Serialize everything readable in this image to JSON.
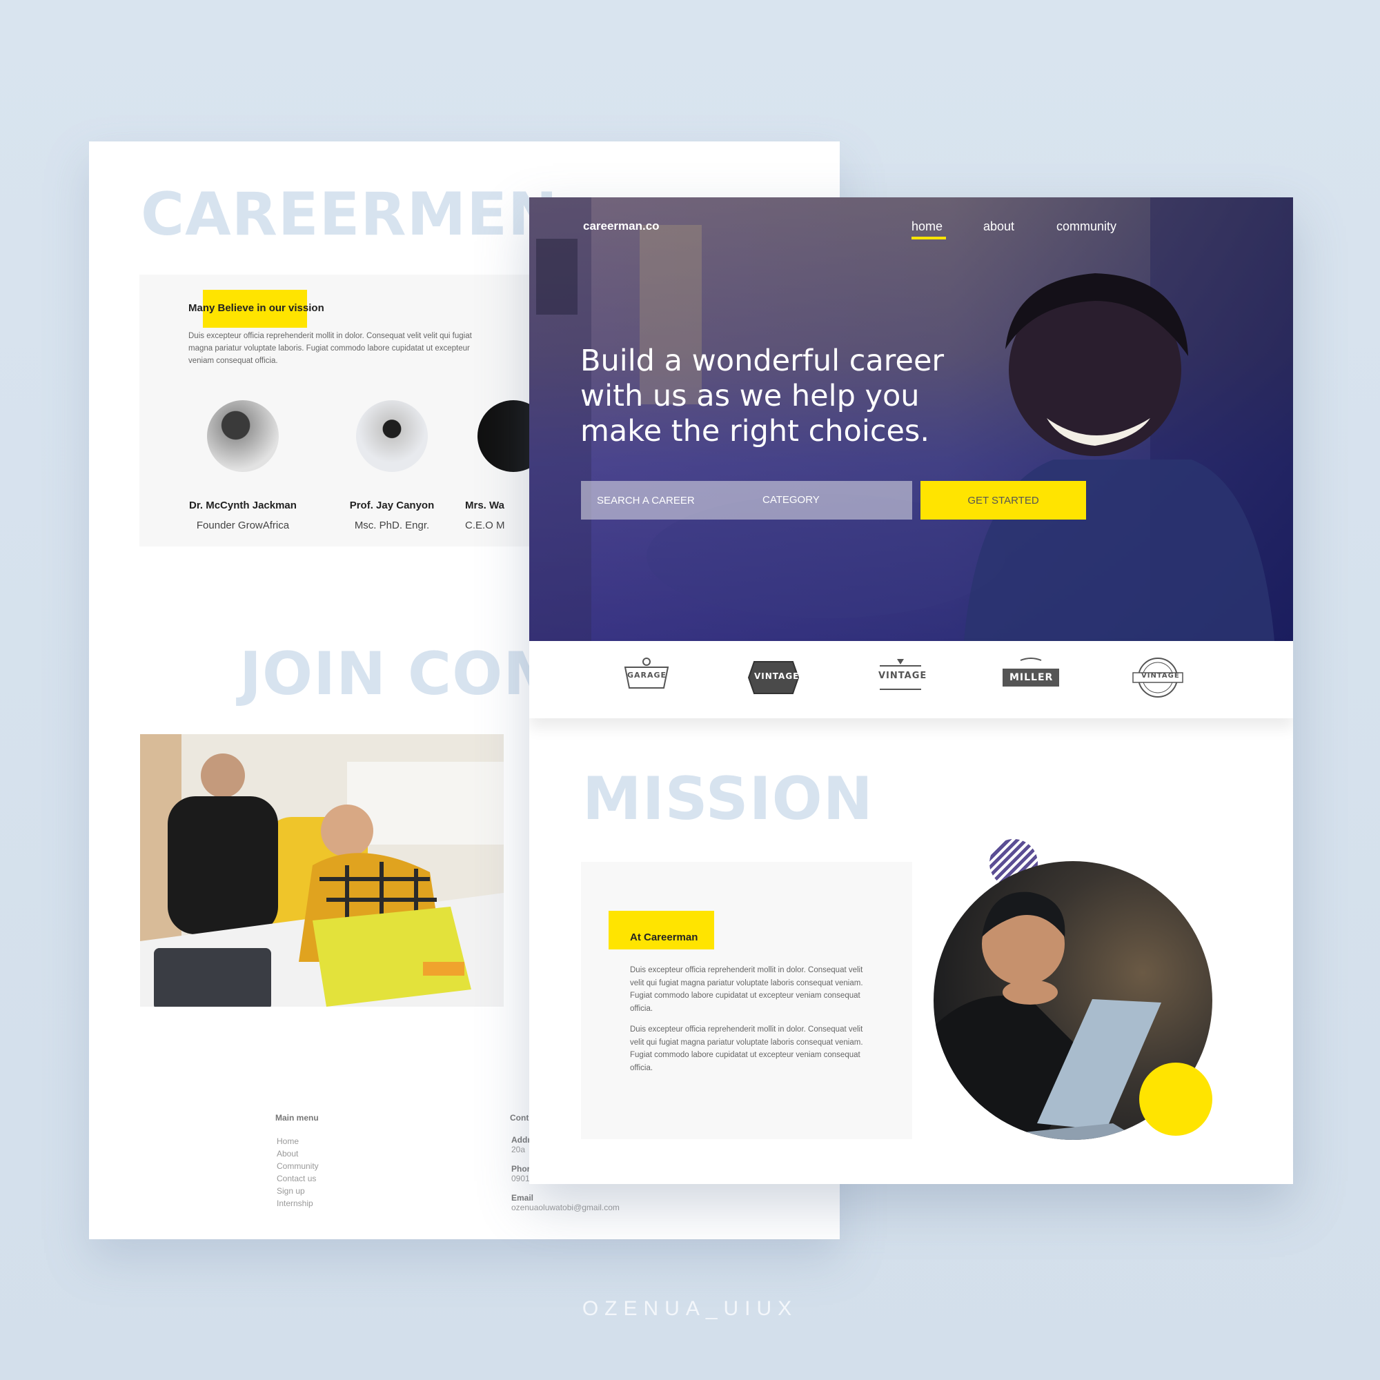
{
  "back_page": {
    "title": "CAREERMEN",
    "vision": {
      "title": "Many Believe in our vission",
      "body": "Duis excepteur officia reprehenderit mollit in dolor. Consequat velit velit qui fugiat magna pariatur voluptate laboris. Fugiat commodo labore cupidatat ut excepteur veniam consequat officia."
    },
    "people": [
      {
        "name": "Dr. McCynth Jackman",
        "role": "Founder GrowAfrica"
      },
      {
        "name": "Prof. Jay Canyon",
        "role": "Msc. PhD. Engr."
      },
      {
        "name": "Mrs. Wa",
        "role": "C.E.O M"
      }
    ],
    "join_title": "JOIN COM",
    "footer": {
      "menu_title": "Main menu",
      "menu_items": [
        "Home",
        "About",
        "Community",
        "Contact us",
        "Sign up",
        "Internship"
      ],
      "contact_title": "Cont",
      "address_label": "Addr",
      "address_value": "20a",
      "phone_label": "Phor",
      "phone_value": "0901",
      "email_label": "Email",
      "email_value": "ozenuaoluwatobi@gmail.com"
    }
  },
  "front_page": {
    "brand": "careerman.co",
    "nav": {
      "home": "home",
      "about": "about",
      "community": "community",
      "active": "home"
    },
    "hero_headline": "Build a wonderful career with us as we help you make the right choices.",
    "search": {
      "placeholder": "SEARCH A CAREER",
      "category": "CATEGORY",
      "cta": "GET STARTED"
    },
    "logos": [
      {
        "icon": "garage-logo",
        "text": "GARAGE"
      },
      {
        "icon": "vintage-badge-logo",
        "text": "VINTAGE"
      },
      {
        "icon": "vintage-crest-logo",
        "text": "VINTAGE"
      },
      {
        "icon": "miller-logo",
        "text": "MILLER"
      },
      {
        "icon": "vintage-round-logo",
        "text": "VINTAGE"
      }
    ],
    "mission": {
      "title": "MISSION",
      "label": "At Careerman",
      "paragraphs": [
        "Duis excepteur officia reprehenderit mollit in dolor. Consequat velit velit qui fugiat magna pariatur voluptate laboris consequat veniam. Fugiat commodo labore cupidatat ut excepteur veniam consequat officia.",
        "Duis excepteur officia reprehenderit mollit in dolor. Consequat velit velit qui fugiat magna pariatur voluptate laboris consequat veniam. Fugiat commodo labore cupidatat ut excepteur veniam consequat officia."
      ]
    }
  },
  "watermark": "OZENUA_UIUX",
  "colors": {
    "accent": "#ffe400",
    "heading_pale": "#d7e3ef",
    "background": "#d9e4ef"
  }
}
